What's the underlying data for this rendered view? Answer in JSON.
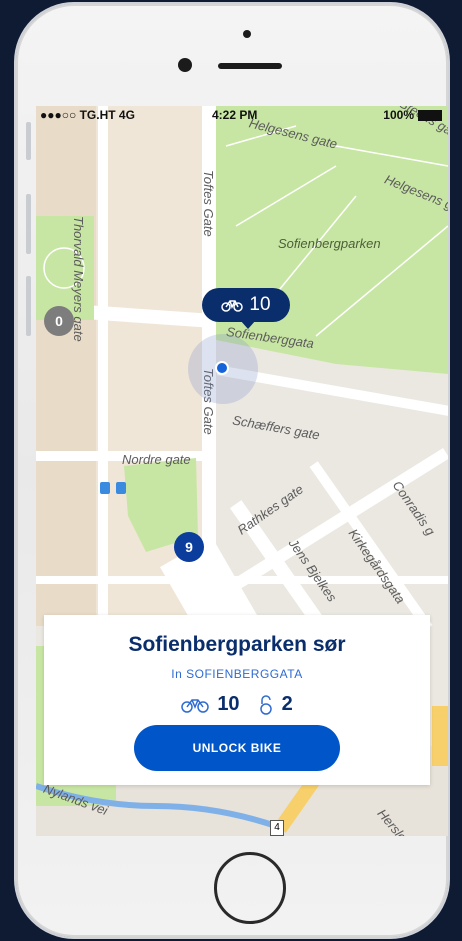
{
  "status_bar": {
    "carrier": "●●●○○ TG.HT  4G",
    "time": "4:22 PM",
    "battery_pct": "100%"
  },
  "map": {
    "streets": [
      "Thorvald Meyers gate",
      "Toftes Gate",
      "Toftes Gate",
      "Sofienberggata",
      "Schæffers gate",
      "Nordre gate",
      "Rathkes gate",
      "Jens Bjelkes",
      "Kirkegårdsgata",
      "Conradis g",
      "Helgesens gate",
      "Helgesens gate",
      "Steens gate",
      "Nylands vei",
      "Hersleb"
    ],
    "park_label": "Sofienbergparken",
    "markers": {
      "cluster_grey": "0",
      "cluster_blue": "9",
      "station_bubble_count": "10"
    },
    "road_sign": "4"
  },
  "station_card": {
    "title": "Sofienbergparken sør",
    "subtitle": "In SOFIENBERGGATA",
    "bikes_available": "10",
    "locks_available": "2",
    "unlock_button": "UNLOCK BIKE"
  },
  "colors": {
    "brand_dark": "#0a2d6b",
    "brand_blue": "#0055c8",
    "park_green": "#c8e6a3",
    "map_bg": "#ebe8e2"
  }
}
